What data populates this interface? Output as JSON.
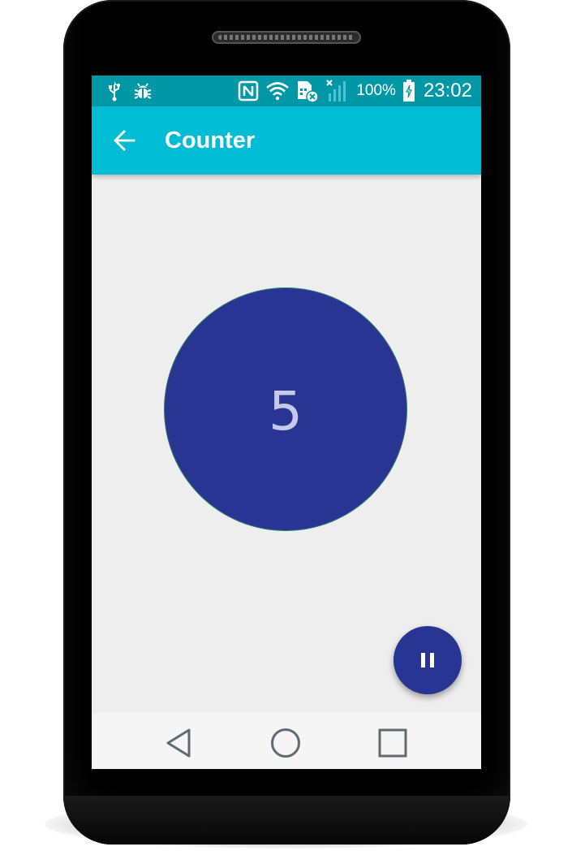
{
  "status_bar": {
    "battery_percent": "100%",
    "time": "23:02",
    "icons_left": [
      "usb-icon",
      "bug-icon"
    ],
    "icons_right": [
      "nfc-icon",
      "wifi-icon",
      "sim-error-icon",
      "signal-icon",
      "battery-charging-icon"
    ]
  },
  "app_bar": {
    "title": "Counter",
    "back_icon": "arrow-back-icon"
  },
  "counter": {
    "value": "5"
  },
  "fab": {
    "icon": "pause-icon"
  },
  "nav_bar": {
    "icons": [
      "back-triangle-icon",
      "home-circle-icon",
      "recents-square-icon"
    ]
  },
  "colors": {
    "status_bar": "#0097a7",
    "app_bar": "#00bcd4",
    "circle": "#283593",
    "counter_text": "#c5cae9",
    "background": "#eeeeee",
    "nav_bar": "#f5f5f5",
    "nav_icon": "#5f6b73"
  }
}
